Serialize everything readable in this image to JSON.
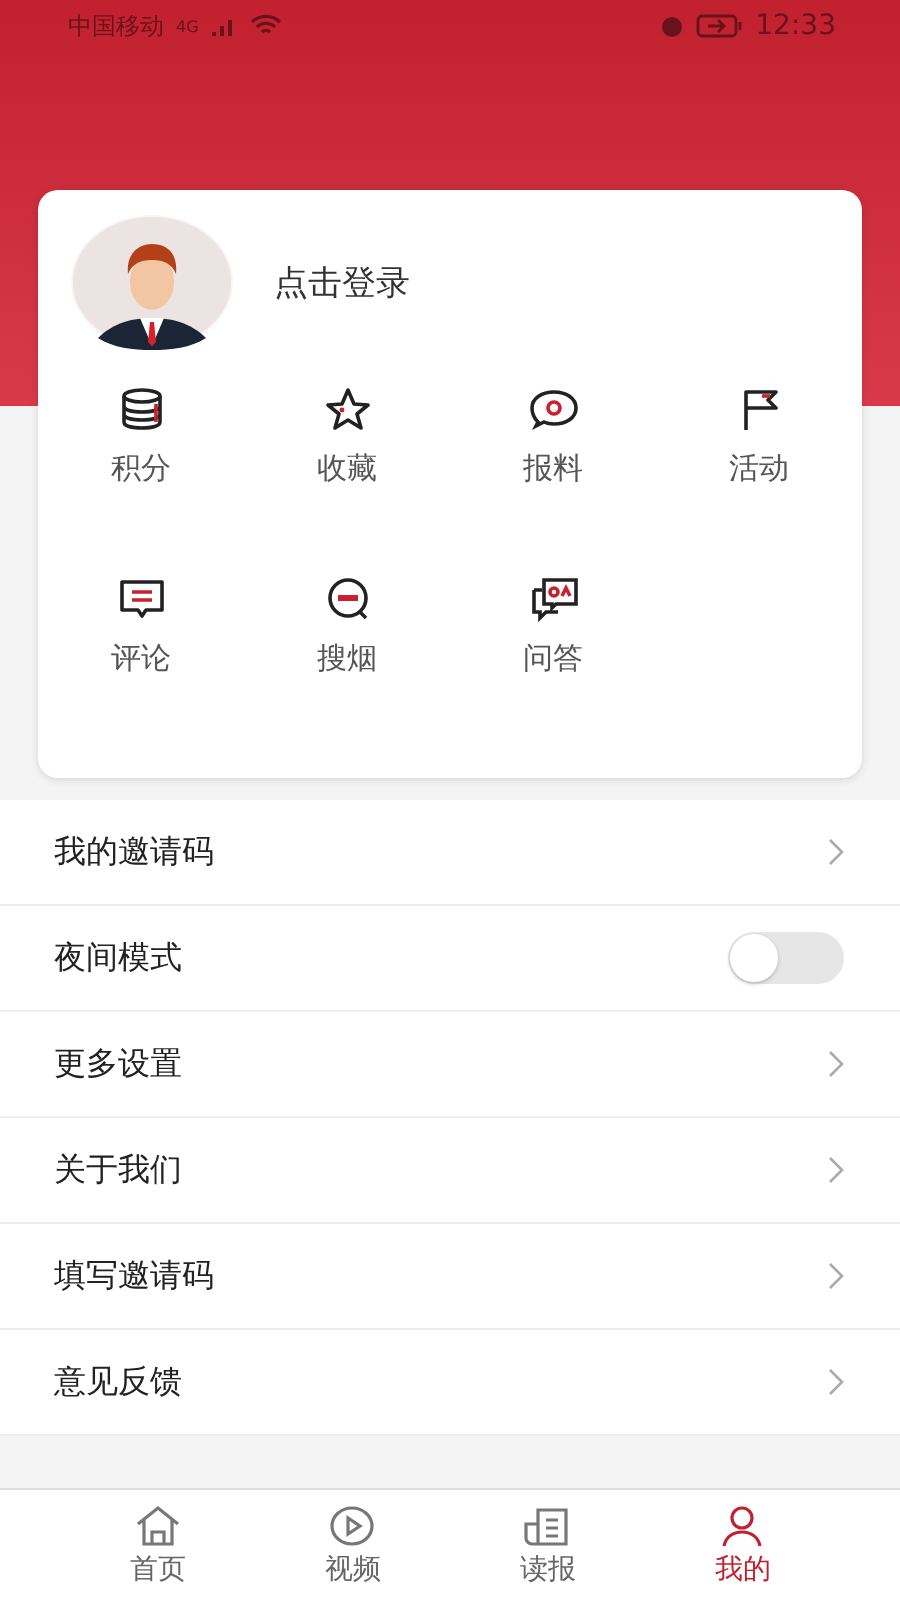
{
  "status_bar": {
    "carrier": "中国移动",
    "network": "4G",
    "time": "12:33"
  },
  "profile": {
    "login_text": "点击登录"
  },
  "shortcuts": [
    {
      "label": "积分",
      "kind": "coins"
    },
    {
      "label": "收藏",
      "kind": "star"
    },
    {
      "label": "报料",
      "kind": "bubble"
    },
    {
      "label": "活动",
      "kind": "flag"
    },
    {
      "label": "评论",
      "kind": "comment"
    },
    {
      "label": "搜烟",
      "kind": "search"
    },
    {
      "label": "问答",
      "kind": "qa"
    }
  ],
  "menu": [
    {
      "label": "我的邀请码",
      "kind": "link"
    },
    {
      "label": "夜间模式",
      "kind": "toggle",
      "on": false
    },
    {
      "label": "更多设置",
      "kind": "link"
    },
    {
      "label": "关于我们",
      "kind": "link"
    },
    {
      "label": "填写邀请码",
      "kind": "link"
    },
    {
      "label": "意见反馈",
      "kind": "link"
    }
  ],
  "tab_bar": [
    {
      "label": "首页",
      "kind": "home",
      "selected": false
    },
    {
      "label": "视频",
      "kind": "play",
      "selected": false
    },
    {
      "label": "读报",
      "kind": "paper",
      "selected": false
    },
    {
      "label": "我的",
      "kind": "person",
      "selected": true
    }
  ]
}
